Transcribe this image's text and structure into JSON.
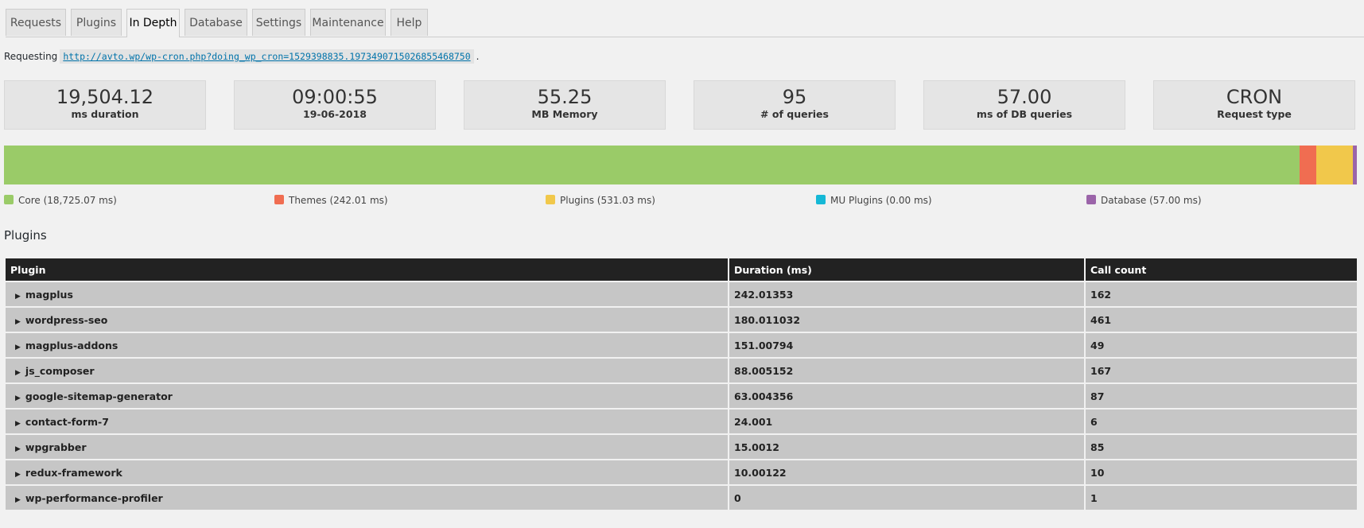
{
  "tabs": [
    "Requests",
    "Plugins",
    "In Depth",
    "Database",
    "Settings",
    "Maintenance",
    "Help"
  ],
  "active_tab": "In Depth",
  "request": {
    "label": "Requesting",
    "url": "http://avto.wp/wp-cron.php?doing_wp_cron=1529398835.1973490715026855468750",
    "suffix": "."
  },
  "cards": [
    {
      "value": "19,504.12",
      "label": "ms duration"
    },
    {
      "value": "09:00:55",
      "label": "19-06-2018"
    },
    {
      "value": "55.25",
      "label": "MB Memory"
    },
    {
      "value": "95",
      "label": "# of queries"
    },
    {
      "value": "57.00",
      "label": "ms of DB queries"
    },
    {
      "value": "CRON",
      "label": "Request type"
    }
  ],
  "breakdown": [
    {
      "label": "Core (18,725.07 ms)",
      "ms": 18725.07,
      "color": "#9acb68"
    },
    {
      "label": "Themes (242.01 ms)",
      "ms": 242.01,
      "color": "#f06d51"
    },
    {
      "label": "Plugins (531.03 ms)",
      "ms": 531.03,
      "color": "#f1c84b"
    },
    {
      "label": "MU Plugins (0.00 ms)",
      "ms": 0,
      "color": "#15b8d6"
    },
    {
      "label": "Database (57.00 ms)",
      "ms": 57.0,
      "color": "#9b64a9"
    }
  ],
  "plugins_section": {
    "title": "Plugins",
    "columns": [
      "Plugin",
      "Duration (ms)",
      "Call count"
    ],
    "rows": [
      [
        "magplus",
        "242.01353",
        "162"
      ],
      [
        "wordpress-seo",
        "180.011032",
        "461"
      ],
      [
        "magplus-addons",
        "151.00794",
        "49"
      ],
      [
        "js_composer",
        "88.005152",
        "167"
      ],
      [
        "google-sitemap-generator",
        "63.004356",
        "87"
      ],
      [
        "contact-form-7",
        "24.001",
        "6"
      ],
      [
        "wpgrabber",
        "15.0012",
        "85"
      ],
      [
        "redux-framework",
        "10.00122",
        "10"
      ],
      [
        "wp-performance-profiler",
        "0",
        "1"
      ]
    ]
  }
}
